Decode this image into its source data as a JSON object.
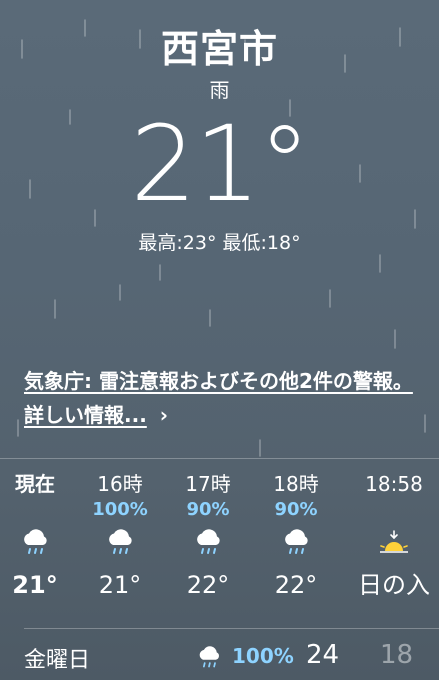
{
  "location": {
    "city": "西宮市",
    "condition": "雨"
  },
  "current": {
    "temperature": "21°",
    "high_low": "最高:23° 最低:18°"
  },
  "alert": {
    "text": "気象庁: 雷注意報およびその他2件の警報。 詳しい情報...",
    "chevron": "›"
  },
  "hourly": [
    {
      "time": "現在",
      "precip": "",
      "icon": "cloud-rain-icon",
      "temp": "21°"
    },
    {
      "time": "16時",
      "precip": "100%",
      "icon": "cloud-rain-icon",
      "temp": "21°"
    },
    {
      "time": "17時",
      "precip": "90%",
      "icon": "cloud-rain-icon",
      "temp": "22°"
    },
    {
      "time": "18時",
      "precip": "90%",
      "icon": "cloud-rain-icon",
      "temp": "22°"
    },
    {
      "time": "18:58",
      "precip": "",
      "icon": "sunset-icon",
      "temp": "日の入"
    }
  ],
  "daily": [
    {
      "day": "金曜日",
      "icon": "cloud-rain-icon",
      "precip": "100%",
      "high": "24",
      "low": "18"
    }
  ],
  "colors": {
    "precip": "#8ed3ff",
    "background": "#566674"
  }
}
